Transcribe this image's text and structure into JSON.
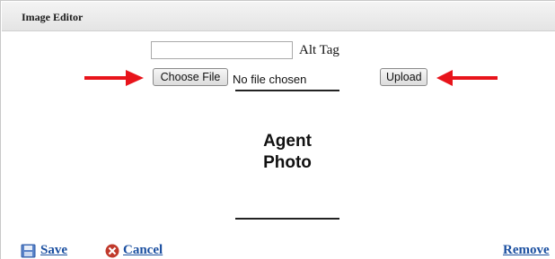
{
  "window": {
    "title": "Image Editor"
  },
  "form": {
    "alt_value": "",
    "alt_label": "Alt Tag",
    "choose_file_label": "Choose File",
    "file_status": "No file chosen",
    "upload_label": "Upload"
  },
  "preview": {
    "line1": "Agent",
    "line2": "Photo"
  },
  "footer": {
    "save_label": "Save",
    "cancel_label": "Cancel",
    "remove_label": "Remove"
  },
  "colors": {
    "link": "#1a4fa0",
    "arrow": "#e8141b",
    "cancel_icon": "#c0392b"
  },
  "icons": {
    "save": "floppy-disk-icon",
    "cancel": "cancel-x-icon",
    "annotation": "red-arrow-icon"
  }
}
